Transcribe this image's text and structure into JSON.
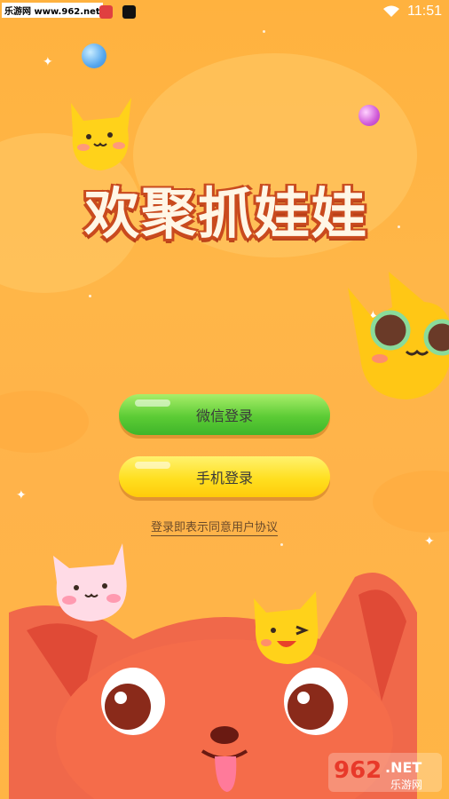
{
  "status_bar": {
    "watermark": "乐游网 www.962.net",
    "time": "11:51",
    "wifi_icon": "wifi-icon"
  },
  "app": {
    "title": "欢聚抓娃娃"
  },
  "login": {
    "wechat_label": "微信登录",
    "phone_label": "手机登录",
    "agreement_text": "登录即表示同意用户协议"
  },
  "watermark_bottom": {
    "brand_number": "962",
    "brand_suffix": ".NET",
    "brand_name": "乐游网"
  },
  "colors": {
    "background": "#ffb545",
    "wechat_button": "#5ccc35",
    "phone_button": "#ffdf20",
    "title_outline": "#c94a1e"
  }
}
